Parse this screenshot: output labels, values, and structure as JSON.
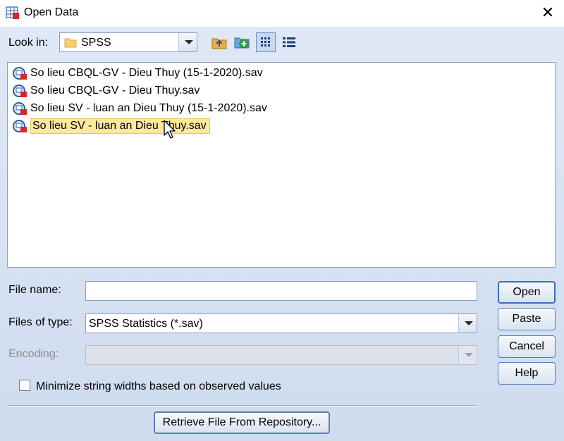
{
  "window": {
    "title": "Open Data",
    "close_glyph": "✕",
    "app_icon": "spss-data-icon"
  },
  "look_in": {
    "label": "Look in:",
    "value": "SPSS",
    "folder_icon": "folder-icon"
  },
  "toolbar": {
    "buttons": [
      "up-one-level-icon",
      "new-folder-icon",
      "list-view-icon",
      "details-view-icon"
    ]
  },
  "files": [
    {
      "name": "So lieu CBQL-GV - Dieu Thuy (15-1-2020).sav",
      "selected": false
    },
    {
      "name": "So lieu CBQL-GV - Dieu Thuy.sav",
      "selected": false
    },
    {
      "name": "So lieu SV - luan an Dieu Thuy (15-1-2020).sav",
      "selected": false
    },
    {
      "name": "So lieu SV - luan an Dieu Thuy.sav",
      "selected": true
    }
  ],
  "file_name": {
    "label": "File name:",
    "value": ""
  },
  "files_of_type": {
    "label": "Files of type:",
    "value": "SPSS Statistics (*.sav)"
  },
  "encoding": {
    "label": "Encoding:",
    "value": ""
  },
  "buttons": {
    "open": "Open",
    "paste": "Paste",
    "cancel": "Cancel",
    "help": "Help"
  },
  "minimize_checkbox": {
    "label": "Minimize string widths based on observed values",
    "checked": false
  },
  "retrieve_button": "Retrieve File From Repository...",
  "colors": {
    "selection_bg": "#fde89c",
    "dialog_bg": "#dfe8f6",
    "button_border": "#5b7fb5"
  }
}
